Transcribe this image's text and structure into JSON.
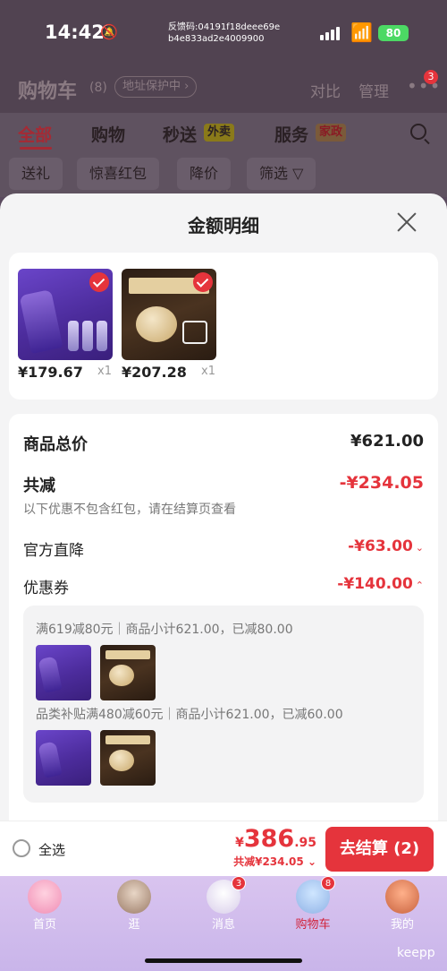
{
  "status_bar": {
    "time": "14:42",
    "feedback_line1": "反馈码:04191f18deee69e",
    "feedback_line2": "b4e833ad2e4009900",
    "battery": "80"
  },
  "cart_header": {
    "title": "购物车",
    "count": "(8)",
    "protect": "地址保护中 ›",
    "compare": "对比",
    "manage": "管理",
    "more": "•••",
    "more_badge": "3"
  },
  "tabs": [
    {
      "label": "全部"
    },
    {
      "label": "购物"
    },
    {
      "label": "秒送",
      "tag": "外卖"
    },
    {
      "label": "服务",
      "tag": "家政"
    }
  ],
  "filters": [
    "送礼",
    "惊喜红包",
    "降价",
    "筛选 ▽"
  ],
  "sheet": {
    "title": "金额明细",
    "products": [
      {
        "price": "¥179.67",
        "qty": "x1"
      },
      {
        "price": "¥207.28",
        "qty": "x1"
      }
    ],
    "rows": {
      "goods_total_label": "商品总价",
      "goods_total_value": "¥621.00",
      "total_reduce_label": "共减",
      "total_reduce_value": "-¥234.05",
      "note": "以下优惠不包含红包，请在结算页查看",
      "official_label": "官方直降",
      "official_value": "-¥63.00",
      "coupon_label": "优惠券",
      "coupon_value": "-¥140.00"
    },
    "coupons": [
      {
        "text": "满619减80元｜商品小计621.00，已减80.00"
      },
      {
        "text": "品类补贴满480减60元｜商品小计621.00，已减60.00"
      }
    ]
  },
  "checkout": {
    "select_all": "全选",
    "yen": "¥",
    "total_int": "386",
    "total_dec": ".95",
    "saving": "共减¥234.05",
    "button": "去结算 (2)"
  },
  "nav": [
    {
      "label": "首页",
      "icon": "home-avatar-icon"
    },
    {
      "label": "逛",
      "icon": "explore-avatar-icon"
    },
    {
      "label": "消息",
      "icon": "message-avatar-icon",
      "badge": "3"
    },
    {
      "label": "购物车",
      "icon": "cart-avatar-icon",
      "badge": "8"
    },
    {
      "label": "我的",
      "icon": "profile-avatar-icon"
    }
  ],
  "watermark": "keepp",
  "colors": {
    "accent": "#e5343c",
    "tab_bar": "#d9c4ef"
  }
}
